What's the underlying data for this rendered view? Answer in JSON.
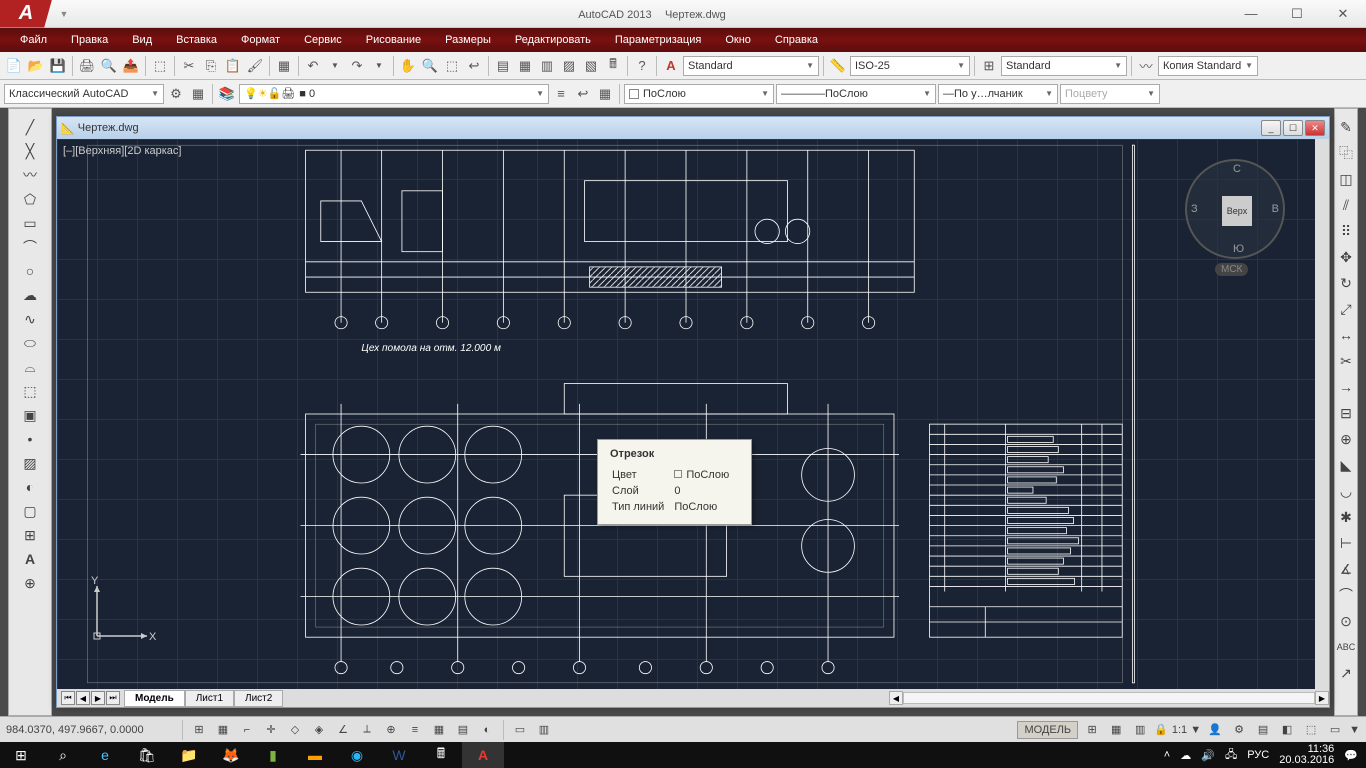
{
  "app": {
    "title_app": "AutoCAD 2013",
    "title_doc": "Чертеж.dwg"
  },
  "menu": [
    "Файл",
    "Правка",
    "Вид",
    "Вставка",
    "Формат",
    "Сервис",
    "Рисование",
    "Размеры",
    "Редактировать",
    "Параметризация",
    "Окно",
    "Справка"
  ],
  "styles": {
    "text": "Standard",
    "dim": "ISO-25",
    "table": "Standard",
    "ml": "Копия Standard"
  },
  "workspace": "Классический AutoCAD",
  "layer": "0",
  "props": {
    "color": "ПоСлою",
    "ltype": "ПоСлою",
    "lweight": "По у…лчаник",
    "plot": "Поцвету"
  },
  "doc": {
    "name": "Чертеж.dwg",
    "viewport": "[–][Верхняя][2D каркас]"
  },
  "viewcube": {
    "face": "Верх",
    "n": "С",
    "e": "В",
    "s": "Ю",
    "w": "З",
    "cs": "МСК"
  },
  "drw_label": "Цех помола на отм. 12.000 м",
  "tooltip": {
    "title": "Отрезок",
    "rows": [
      [
        "Цвет",
        "ПоСлою"
      ],
      [
        "Слой",
        "0"
      ],
      [
        "Тип линий",
        "ПоСлою"
      ]
    ]
  },
  "tabs": {
    "model": "Модель",
    "l1": "Лист1",
    "l2": "Лист2"
  },
  "status": {
    "coords": "984.0370, 497.9667, 0.0000",
    "space": "МОДЕЛЬ",
    "scale": "1:1"
  },
  "tray": {
    "lang": "РУС",
    "time": "11:36",
    "date": "20.03.2016"
  },
  "ucs": {
    "x": "X",
    "y": "Y"
  }
}
